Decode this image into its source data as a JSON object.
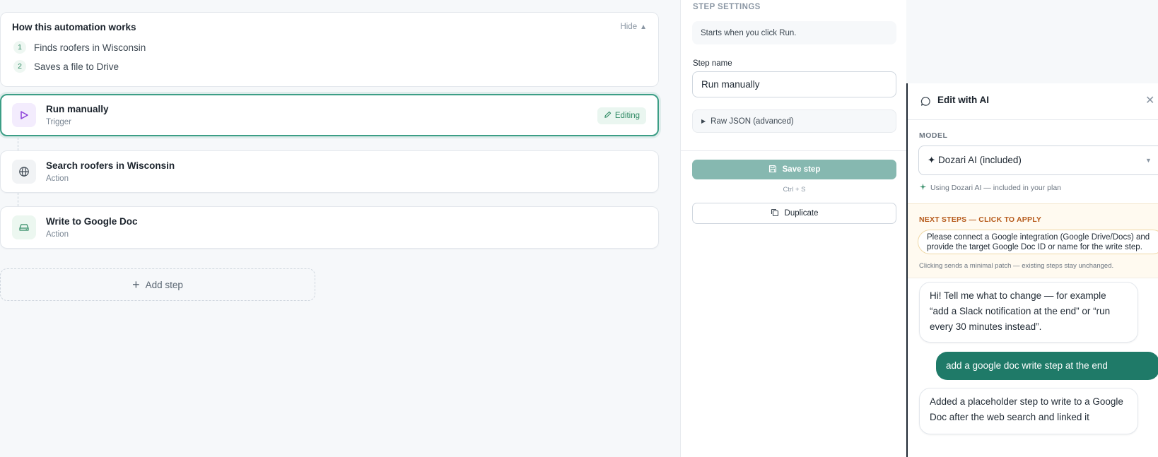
{
  "how_it_works": {
    "title": "How this automation works",
    "hide_label": "Hide",
    "steps": [
      {
        "num": "1",
        "text": "Finds roofers in Wisconsin"
      },
      {
        "num": "2",
        "text": "Saves a file to Drive"
      }
    ]
  },
  "flow": {
    "steps": [
      {
        "title": "Run manually",
        "subtitle": "Trigger",
        "icon": "play-icon",
        "badge": "Editing"
      },
      {
        "title": "Search roofers in Wisconsin",
        "subtitle": "Action",
        "icon": "globe-icon"
      },
      {
        "title": "Write to Google Doc",
        "subtitle": "Action",
        "icon": "drive-icon"
      }
    ],
    "add_step_label": "Add step"
  },
  "step_settings": {
    "heading": "STEP SETTINGS",
    "description": "Starts when you click Run.",
    "step_name_label": "Step name",
    "step_name_value": "Run manually",
    "raw_json_label": "Raw JSON (advanced)",
    "save_label": "Save step",
    "shortcut": "Ctrl + S",
    "duplicate_label": "Duplicate"
  },
  "ai_panel": {
    "title": "Edit with AI",
    "model_label": "MODEL",
    "model_value": "✦ Dozari AI (included)",
    "model_note": "Using Dozari AI — included in your plan",
    "next_steps_heading": "NEXT STEPS — CLICK TO APPLY",
    "next_step_suggestion": "Please connect a Google integration (Google Drive/Docs) and provide the target Google Doc ID or name for the write step.",
    "next_steps_footnote": "Clicking sends a minimal patch — existing steps stay unchanged.",
    "messages": [
      {
        "role": "assistant",
        "text": "Hi! Tell me what to change — for example “add a Slack notification at the end” or “run every 30 minutes instead”."
      },
      {
        "role": "user",
        "text": "add a google doc write step at the end"
      },
      {
        "role": "assistant",
        "text": "Added a placeholder step to write to a Google Doc after the web search and linked it"
      }
    ]
  },
  "colors": {
    "accent": "#3c9e86",
    "user_bubble": "#1f7a68",
    "save_button": "#86b8b0",
    "next_steps_heading": "#b65a1b",
    "trigger_icon": "#8b3fd9"
  }
}
